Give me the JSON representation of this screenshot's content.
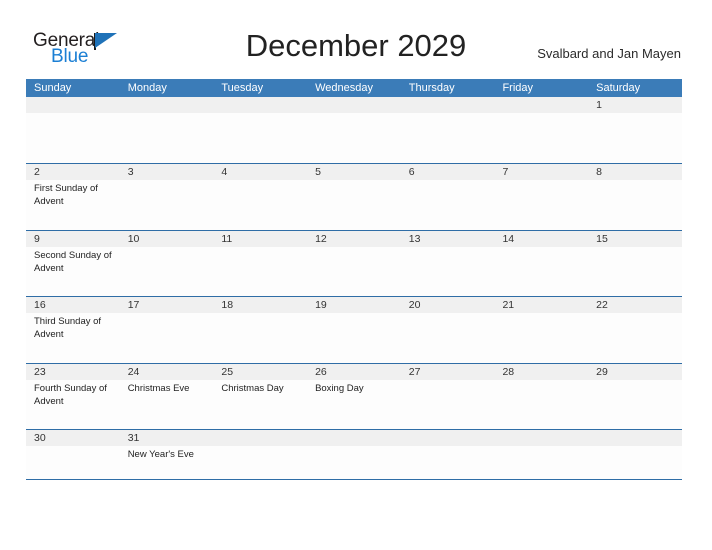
{
  "branding": {
    "name_part1": "General",
    "name_part2": "Blue",
    "triangle_icon": "triangle-logo-icon"
  },
  "header": {
    "title": "December 2029",
    "region": "Svalbard and Jan Mayen"
  },
  "colors": {
    "header_blue": "#3b7cb8",
    "rule_blue": "#2f6da6",
    "daynum_band": "#f0f0f0",
    "logo_blue": "#1b7fd4",
    "logo_dark": "#231f20"
  },
  "calendar": {
    "weekdays": [
      "Sunday",
      "Monday",
      "Tuesday",
      "Wednesday",
      "Thursday",
      "Friday",
      "Saturday"
    ],
    "weeks": [
      {
        "days": [
          {
            "num": "",
            "events": []
          },
          {
            "num": "",
            "events": []
          },
          {
            "num": "",
            "events": []
          },
          {
            "num": "",
            "events": []
          },
          {
            "num": "",
            "events": []
          },
          {
            "num": "",
            "events": []
          },
          {
            "num": "1",
            "events": []
          }
        ]
      },
      {
        "days": [
          {
            "num": "2",
            "events": [
              "First Sunday of Advent"
            ]
          },
          {
            "num": "3",
            "events": []
          },
          {
            "num": "4",
            "events": []
          },
          {
            "num": "5",
            "events": []
          },
          {
            "num": "6",
            "events": []
          },
          {
            "num": "7",
            "events": []
          },
          {
            "num": "8",
            "events": []
          }
        ]
      },
      {
        "days": [
          {
            "num": "9",
            "events": [
              "Second Sunday of Advent"
            ]
          },
          {
            "num": "10",
            "events": []
          },
          {
            "num": "11",
            "events": []
          },
          {
            "num": "12",
            "events": []
          },
          {
            "num": "13",
            "events": []
          },
          {
            "num": "14",
            "events": []
          },
          {
            "num": "15",
            "events": []
          }
        ]
      },
      {
        "days": [
          {
            "num": "16",
            "events": [
              "Third Sunday of Advent"
            ]
          },
          {
            "num": "17",
            "events": []
          },
          {
            "num": "18",
            "events": []
          },
          {
            "num": "19",
            "events": []
          },
          {
            "num": "20",
            "events": []
          },
          {
            "num": "21",
            "events": []
          },
          {
            "num": "22",
            "events": []
          }
        ]
      },
      {
        "days": [
          {
            "num": "23",
            "events": [
              "Fourth Sunday of Advent"
            ]
          },
          {
            "num": "24",
            "events": [
              "Christmas Eve"
            ]
          },
          {
            "num": "25",
            "events": [
              "Christmas Day"
            ]
          },
          {
            "num": "26",
            "events": [
              "Boxing Day"
            ]
          },
          {
            "num": "27",
            "events": []
          },
          {
            "num": "28",
            "events": []
          },
          {
            "num": "29",
            "events": []
          }
        ]
      },
      {
        "days": [
          {
            "num": "30",
            "events": []
          },
          {
            "num": "31",
            "events": [
              "New Year's Eve"
            ]
          },
          {
            "num": "",
            "events": []
          },
          {
            "num": "",
            "events": []
          },
          {
            "num": "",
            "events": []
          },
          {
            "num": "",
            "events": []
          },
          {
            "num": "",
            "events": []
          }
        ]
      }
    ]
  }
}
